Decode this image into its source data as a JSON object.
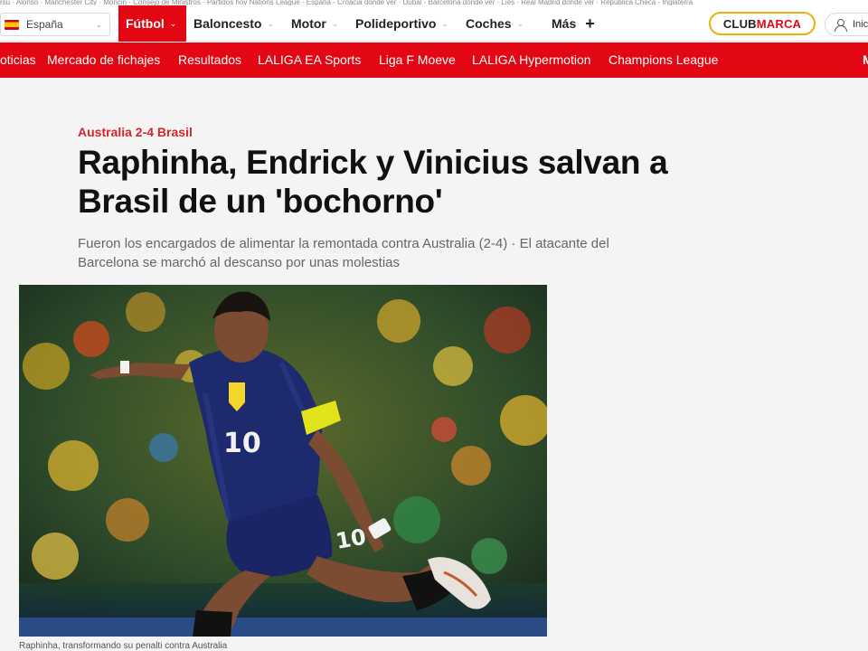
{
  "trending": "rsu · Alonso · Manchester City · Moncin · Consejo de Ministros · Partidos hoy Nations League · España - Croacia dónde ver · Dubai - Barcelona dónde ver · Lies · Real Madrid dónde ver · República Checa - Inglaterra",
  "region": {
    "label": "España",
    "chevron": "⌄"
  },
  "nav": [
    {
      "label": "Fútbol",
      "chevron": "⌄"
    },
    {
      "label": "Baloncesto",
      "chevron": "⌄"
    },
    {
      "label": "Motor",
      "chevron": "⌄"
    },
    {
      "label": "Polideportivo",
      "chevron": "⌄"
    },
    {
      "label": "Coches",
      "chevron": "⌄"
    },
    {
      "label": "Más",
      "plus": "+"
    }
  ],
  "club": {
    "club": "CLUB",
    "marca": "MARCA"
  },
  "login": {
    "label": "Inic"
  },
  "subnav": [
    "oticias",
    "Mercado de fichajes",
    "Resultados",
    "LALIGA EA Sports",
    "Liga F Moeve",
    "LALIGA Hypermotion",
    "Champions League"
  ],
  "subnav_edge": "M",
  "article": {
    "kicker": "Australia 2-4 Brasil",
    "headline": "Raphinha, Endrick y Vinicius salvan a Brasil de un 'bochorno'",
    "summary": "Fueron los encargados de alimentar la remontada contra Australia (2-4) · El atacante del Barcelona se marchó al descanso por unas molestias",
    "caption": "Raphinha, transformando su penalti contra Australia"
  },
  "photo": {
    "shirt_number": "10",
    "shorts_number": "10"
  },
  "colors": {
    "brand_red": "#e30613",
    "kicker_red": "#d4252c",
    "club_gold": "#e8b10c"
  }
}
